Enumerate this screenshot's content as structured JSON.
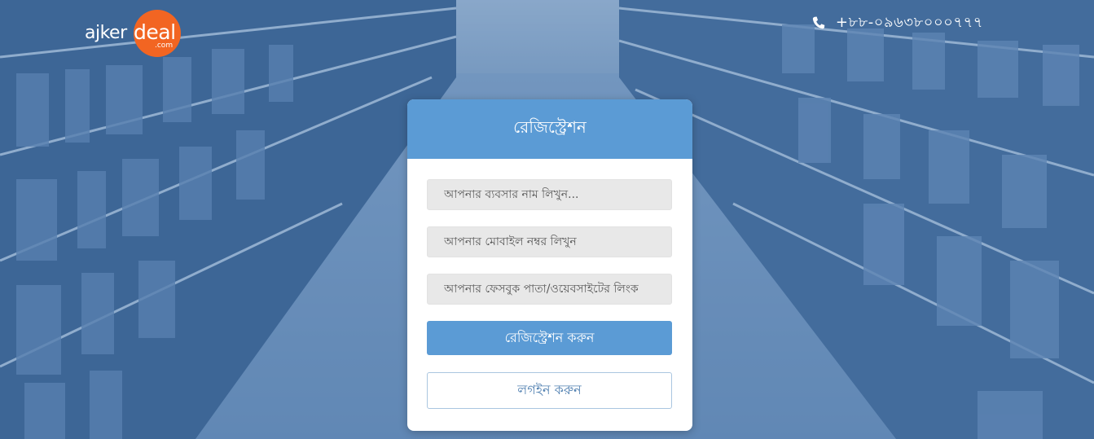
{
  "header": {
    "logo_text": "ajker",
    "logo_accent": "deal",
    "logo_suffix": ".com",
    "phone_icon": "phone-icon",
    "phone_number": "+৮৮-০৯৬৩৮০০০৭৭৭"
  },
  "form": {
    "title": "রেজিস্ট্রেশন",
    "business_name_placeholder": "আপনার ব্যবসার নাম লিখুন...",
    "mobile_placeholder": "আপনার মোবাইল নম্বর লিখুন",
    "facebook_placeholder": "আপনার ফেসবুক পাতা/ওয়েবসাইটের লিংক",
    "register_button": "রেজিস্ট্রেশন করুন",
    "login_button": "লগইন করুন"
  },
  "colors": {
    "brand_orange": "#f26522",
    "primary_blue": "#5b9bd5",
    "overlay_blue": "#3c6eaa"
  }
}
